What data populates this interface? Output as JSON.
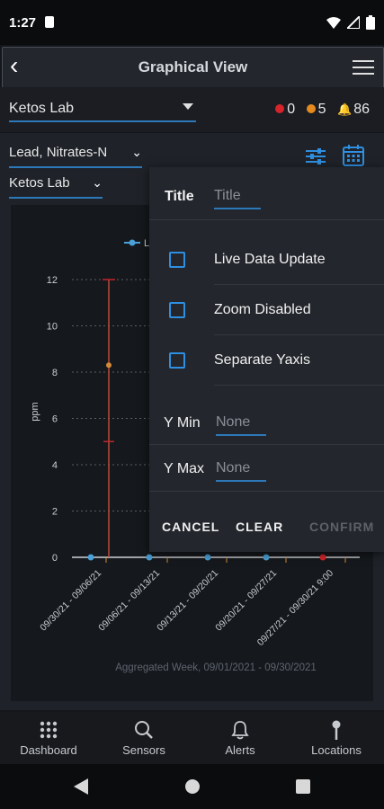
{
  "status_bar": {
    "time": "1:27"
  },
  "header": {
    "title": "Graphical View"
  },
  "filters": {
    "lab_select": "Ketos Lab",
    "counts": {
      "red": "0",
      "orange": "5",
      "bell": "86"
    },
    "colors": {
      "red": "#d6242a",
      "orange": "#e58a1f",
      "accent": "#2d78b8"
    },
    "parameter_select": "Lead, Nitrates-N",
    "location_select": "Ketos Lab"
  },
  "chart_data": {
    "type": "line",
    "ylabel": "ppm",
    "ylim": [
      0,
      12
    ],
    "yticks": [
      "0",
      "2",
      "4",
      "6",
      "8",
      "10",
      "12"
    ],
    "categories": [
      "09/30/21 - 09/06/21",
      "09/06/21 - 09/13/21",
      "09/13/21 - 09/20/21",
      "09/20/21 - 09/27/21",
      "09/27/21 - 09/30/21 9:00"
    ],
    "legend": [
      "L"
    ],
    "footer": "Aggregated Week, 09/01/2021 - 09/30/2021",
    "series": [
      {
        "name": "L",
        "values": [
          0,
          0,
          0,
          0,
          0
        ],
        "color": "#4aa0d8"
      }
    ],
    "error_bar": {
      "x_index": 0,
      "low": 0,
      "high": 12,
      "mean": 8.3,
      "median": 5,
      "color": "#c0262b"
    },
    "last_point_color": "#d6242a"
  },
  "popup": {
    "title_label": "Title",
    "title_placeholder": "Title",
    "options": [
      "Live Data Update",
      "Zoom Disabled",
      "Separate Yaxis"
    ],
    "ymin_label": "Y Min",
    "ymin_value": "None",
    "ymax_label": "Y Max",
    "ymax_value": "None",
    "cancel": "CANCEL",
    "clear": "CLEAR",
    "confirm": "CONFIRM"
  },
  "bottom_nav": [
    {
      "label": "Dashboard",
      "icon": "grid-icon"
    },
    {
      "label": "Sensors",
      "icon": "search-icon"
    },
    {
      "label": "Alerts",
      "icon": "bell-icon"
    },
    {
      "label": "Locations",
      "icon": "pin-icon"
    }
  ]
}
